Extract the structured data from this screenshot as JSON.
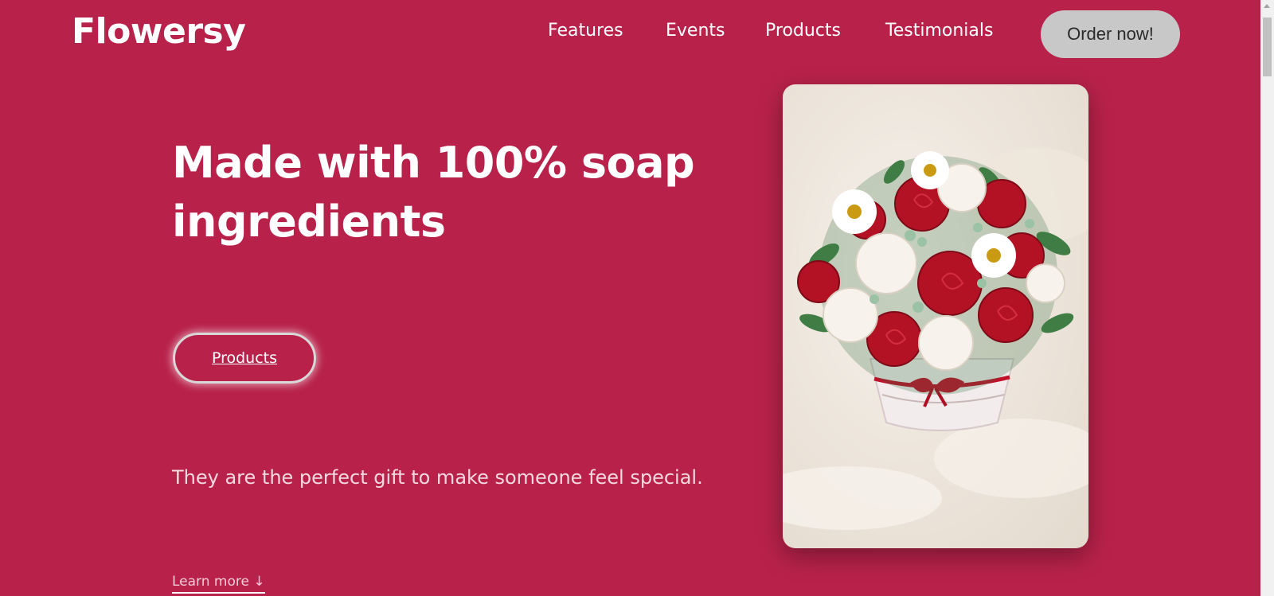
{
  "brand": {
    "logo": "Flowersy"
  },
  "nav": {
    "items": [
      {
        "label": "Features"
      },
      {
        "label": "Events"
      },
      {
        "label": "Products"
      },
      {
        "label": "Testimonials"
      }
    ],
    "cta_label": "Order now!"
  },
  "hero": {
    "headline": "Made with 100% soap ingredients",
    "button_label": "Products",
    "tagline": "They are the perfect gift to make someone feel special.",
    "learn_more": "Learn more ↓"
  },
  "colors": {
    "background": "#b8224a",
    "cta_background": "#c8c8c8",
    "text": "#ffffff"
  },
  "image": {
    "alt": "soap-flower-bouquet-photo"
  }
}
